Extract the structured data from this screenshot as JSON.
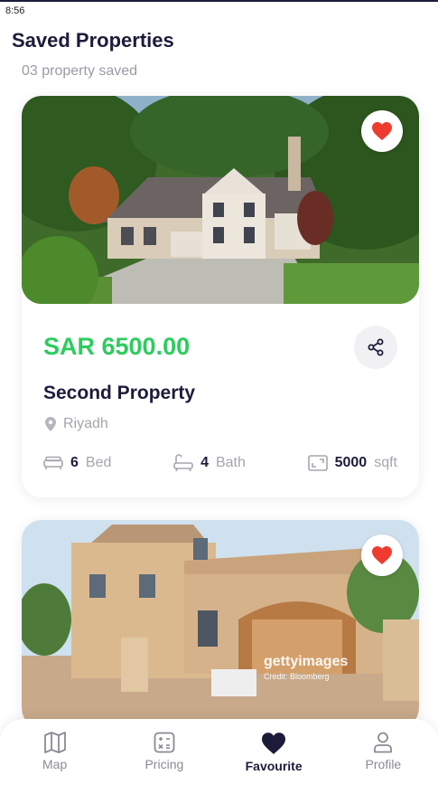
{
  "status": {
    "time": "8:56"
  },
  "page": {
    "title": "Saved Properties",
    "count_text": "03 property saved"
  },
  "properties": [
    {
      "price": "SAR 6500.00",
      "name": "Second Property",
      "location": "Riyadh",
      "bed": "6",
      "bed_unit": "Bed",
      "bath": "4",
      "bath_unit": "Bath",
      "area": "5000",
      "area_unit": "sqft",
      "favourite": true
    },
    {
      "watermark": "gettyimages",
      "watermark_credit": "Credit: Bloomberg",
      "favourite": true
    }
  ],
  "nav": {
    "items": [
      {
        "label": "Map",
        "icon": "map-icon"
      },
      {
        "label": "Pricing",
        "icon": "calculator-icon"
      },
      {
        "label": "Favourite",
        "icon": "heart-icon",
        "active": true
      },
      {
        "label": "Profile",
        "icon": "user-icon"
      }
    ]
  },
  "colors": {
    "accent_green": "#2ecc5f",
    "heart_red": "#ee3b2d",
    "navy": "#1c1c3a",
    "muted": "#a5a5ad"
  }
}
